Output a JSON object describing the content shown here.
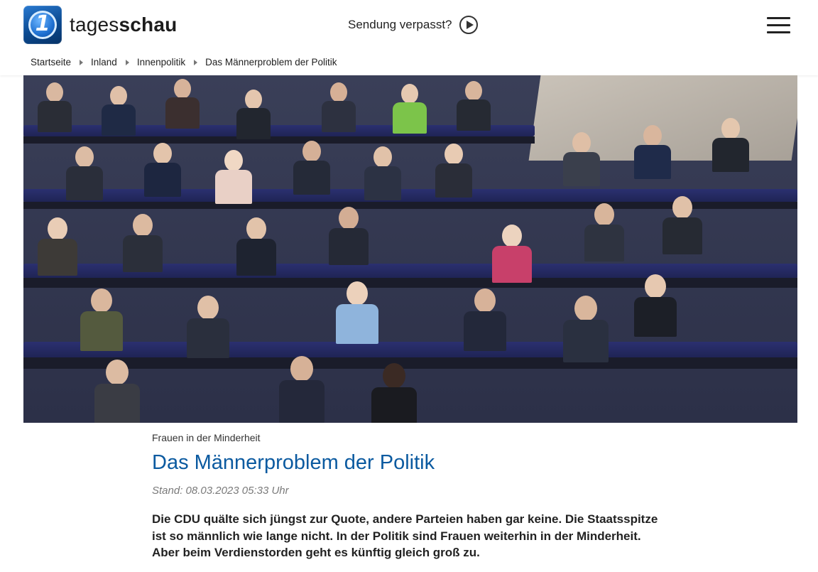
{
  "header": {
    "brand_light": "tages",
    "brand_bold": "schau",
    "missed_label": "Sendung verpasst?",
    "icons": {
      "logo": "ard-one-logo",
      "play": "play-circle-icon",
      "menu": "hamburger-menu-icon"
    }
  },
  "breadcrumb": [
    {
      "label": "Startseite"
    },
    {
      "label": "Inland"
    },
    {
      "label": "Innenpolitik"
    },
    {
      "label": "Das Männerproblem der Politik"
    }
  ],
  "article": {
    "kicker": "Frauen in der Minderheit",
    "title": "Das Männerproblem der Politik",
    "date": "Stand: 08.03.2023 05:33 Uhr",
    "lead": "Die CDU quälte sich jüngst zur Quote, andere Parteien haben gar keine. Die Staatsspitze ist so männlich wie lange nicht. In der Politik sind Frauen weiterhin in der Minderheit. Aber beim Verdienstorden geht es künftig gleich groß zu."
  },
  "colors": {
    "title": "#0b5aa0",
    "accent": "#0b4a91",
    "date": "#7a7a7a"
  }
}
